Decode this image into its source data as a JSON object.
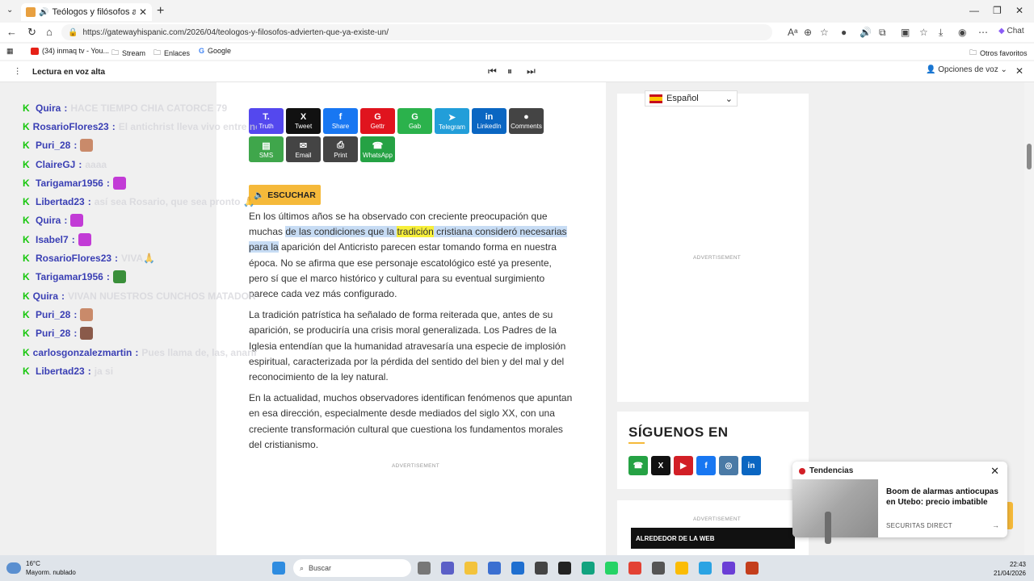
{
  "browser": {
    "tab_title": "Teólogos y filósofos advierten",
    "new_tab": "+",
    "url": "https://gatewayhispanic.com/2026/04/teologos-y-filosofos-advierten-que-ya-existe-un/",
    "chat_label": "Chat",
    "bookmarks": [
      "(34) inmaq tv - You...",
      "Stream",
      "Enlaces",
      "Google"
    ],
    "other_favorites": "Otros favoritos"
  },
  "read_aloud": {
    "label": "Lectura en voz alta",
    "options": "Opciones de voz"
  },
  "share_buttons": [
    {
      "label": "Truth",
      "icon": "T.",
      "color": "#5448ee"
    },
    {
      "label": "Tweet",
      "icon": "X",
      "color": "#111111"
    },
    {
      "label": "Share",
      "icon": "f",
      "color": "#1877f2"
    },
    {
      "label": "Gettr",
      "icon": "G",
      "color": "#e0141e"
    },
    {
      "label": "Gab",
      "icon": "G",
      "color": "#2bb24c"
    },
    {
      "label": "Telegram",
      "icon": "➤",
      "color": "#229ed9"
    },
    {
      "label": "LinkedIn",
      "icon": "in",
      "color": "#0a66c2"
    },
    {
      "label": "Comments",
      "icon": "●",
      "color": "#444444"
    },
    {
      "label": "SMS",
      "icon": "▤",
      "color": "#3fa64b"
    },
    {
      "label": "Email",
      "icon": "✉",
      "color": "#444444"
    },
    {
      "label": "Print",
      "icon": "⎙",
      "color": "#444444"
    },
    {
      "label": "WhatsApp",
      "icon": "☎",
      "color": "#25a244"
    }
  ],
  "listen_button": "ESCUCHAR",
  "article": {
    "p1_a": "En los últimos años se ha observado con creciente preocupación que muchas ",
    "p1_hl1": "de las condiciones que la ",
    "p1_word": "tradición",
    "p1_hl2": " cristiana consideró necesarias para la",
    "p1_b": " aparición del Anticristo parecen estar tomando forma en nuestra época. No se afirma que ese personaje escatológico esté ya presente, pero sí que el marco histórico y cultural para su eventual surgimiento parece cada vez más configurado.",
    "p2": "La tradición patrística ha señalado de forma reiterada que, antes de su aparición, se produciría una crisis moral generalizada. Los Padres de la Iglesia entendían que la humanidad atravesaría una especie de implosión espiritual, caracterizada por la pérdida del sentido del bien y del mal y del reconocimiento de la ley natural.",
    "p3": "En la actualidad, muchos observadores identifican fenómenos que apuntan en esa dirección, especialmente desde mediados del siglo XX, con una creciente transformación cultural que cuestiona los fundamentos morales del cristianismo."
  },
  "ads": {
    "label": "ADVERTISEMENT"
  },
  "sidebar": {
    "language": "Español",
    "follow_title": "SÍGUENOS EN",
    "web_bar": "ALREDEDOR DE LA WEB",
    "socials": [
      {
        "name": "whatsapp-icon",
        "glyph": "☎",
        "color": "#25a244"
      },
      {
        "name": "x-icon",
        "glyph": "X",
        "color": "#111111"
      },
      {
        "name": "youtube-icon",
        "glyph": "▶",
        "color": "#d21f26"
      },
      {
        "name": "facebook-icon",
        "glyph": "f",
        "color": "#1877f2"
      },
      {
        "name": "instagram-icon",
        "glyph": "◎",
        "color": "#4a7aa6"
      },
      {
        "name": "linkedin-icon",
        "glyph": "in",
        "color": "#0a66c2"
      }
    ]
  },
  "chat": [
    {
      "user": "Quira",
      "msg": "HACE TIEMPO CHIA CATORCE 79"
    },
    {
      "user": "RosarioFlores23",
      "msg": "El antichrist lleva vivo entre nosotros"
    },
    {
      "user": "Puri_28",
      "msg": "",
      "emote": "#c98a6a"
    },
    {
      "user": "ClaireGJ",
      "msg": "aaaa"
    },
    {
      "user": "Tarigamar1956",
      "msg": "",
      "emote": "#c23bd6"
    },
    {
      "user": "Libertad23",
      "msg": "así sea Rosario, que sea pronto 🙏",
      "pray": true
    },
    {
      "user": "Quira",
      "msg": "",
      "emote": "#c23bd6"
    },
    {
      "user": "Isabel7",
      "msg": "",
      "emote": "#c23bd6"
    },
    {
      "user": "RosarioFlores23",
      "msg": "VIVA🙏"
    },
    {
      "user": "Tarigamar1956",
      "msg": "",
      "emote": "#3a8f3a"
    },
    {
      "user": "Quira",
      "msg": "VIVAN NUESTROS CUNCHOS MATADORY"
    },
    {
      "user": "Puri_28",
      "msg": "",
      "emote": "#c98a6a"
    },
    {
      "user": "Puri_28",
      "msg": "",
      "emote": "#8a5a4a"
    },
    {
      "user": "carlosgonzalezmartin",
      "msg": "Pues llama de, las, anarinos"
    },
    {
      "user": "Libertad23",
      "msg": "ja si"
    }
  ],
  "notification": {
    "header": "Tendencias",
    "title": "Boom de alarmas antiocupas en Utebo: precio imbatible",
    "source": "SECURITAS DIRECT"
  },
  "taskbar": {
    "temp": "16°C",
    "weather": "Mayorm. nublado",
    "search": "Buscar",
    "time": "22:43",
    "date": "21/04/2026"
  }
}
